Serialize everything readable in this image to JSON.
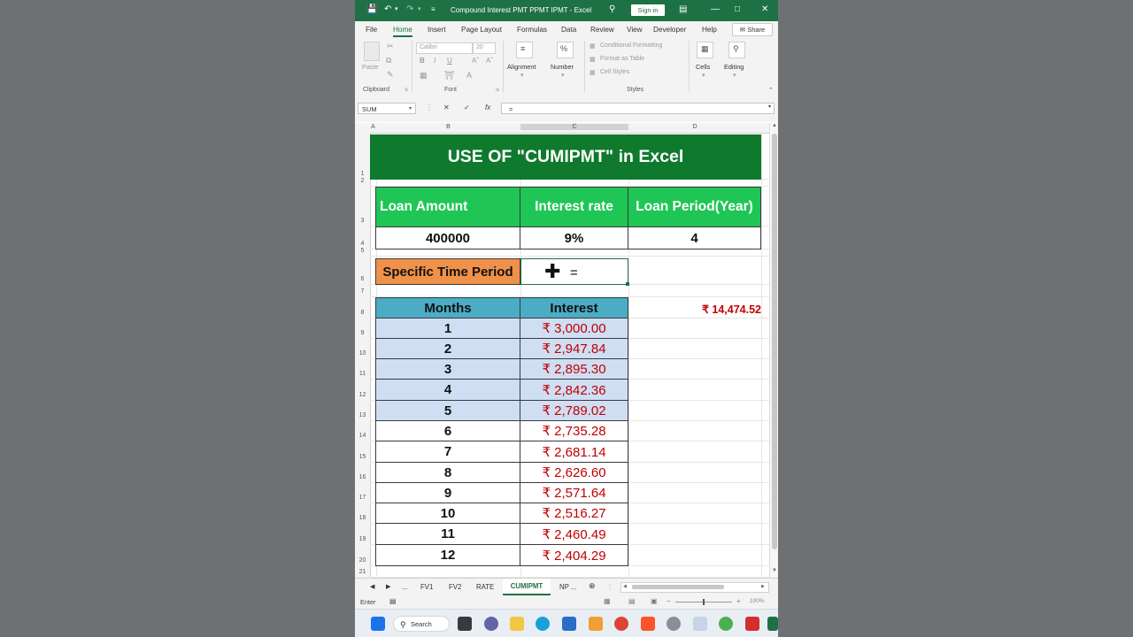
{
  "titlebar": {
    "doc_title": "Compound Interest PMT PPMT IPMT  -  Excel",
    "sign_in": "Sign in"
  },
  "menu": {
    "tabs": [
      "File",
      "Home",
      "Insert",
      "Page Layout",
      "Formulas",
      "Data",
      "Review",
      "View",
      "Developer",
      "Help"
    ],
    "share": "Share"
  },
  "ribbon": {
    "clipboard": {
      "paste": "Paste",
      "label": "Clipboard"
    },
    "font": {
      "name": "Calibri",
      "size": "20",
      "label": "Font",
      "bold": "B",
      "italic": "I",
      "underline": "U"
    },
    "alignment": "Alignment",
    "number": "Number",
    "styles": {
      "conditional": "Conditional Formatting",
      "format_table": "Format as Table",
      "cell_styles": "Cell Styles",
      "label": "Styles"
    },
    "cells": "Cells",
    "editing": "Editing"
  },
  "formula_bar": {
    "name_box": "SUM",
    "content": "="
  },
  "columns": [
    "A",
    "B",
    "C",
    "D"
  ],
  "rows": [
    "1",
    "2",
    "3",
    "4",
    "5",
    "6",
    "7",
    "8",
    "9",
    "10",
    "11",
    "12",
    "13",
    "14",
    "15",
    "16",
    "17",
    "18",
    "19",
    "20",
    "21"
  ],
  "sheet": {
    "banner": "USE OF \"CUMIPMT\" in Excel",
    "headers": [
      "Loan Amount",
      "Interest rate",
      "Loan Period(Year)"
    ],
    "values": [
      "400000",
      "9%",
      "4"
    ],
    "specific_label": "Specific Time Period",
    "specific_value": "=",
    "table_headers": [
      "Months",
      "Interest"
    ],
    "months": [
      "1",
      "2",
      "3",
      "4",
      "5",
      "6",
      "7",
      "8",
      "9",
      "10",
      "11",
      "12"
    ],
    "interest": [
      "₹ 3,000.00",
      "₹ 2,947.84",
      "₹ 2,895.30",
      "₹ 2,842.36",
      "₹ 2,789.02",
      "₹ 2,735.28",
      "₹ 2,681.14",
      "₹ 2,626.60",
      "₹ 2,571.64",
      "₹ 2,516.27",
      "₹ 2,460.49",
      "₹ 2,404.29"
    ],
    "d8_total": "₹ 14,474.52"
  },
  "sheet_tabs": [
    "...",
    "FV1",
    "FV2",
    "RATE",
    "CUMIPMT",
    "NP ..."
  ],
  "status": {
    "mode": "Enter",
    "zoom": "100%"
  },
  "taskbar": {
    "search": "Search"
  },
  "colors": {
    "excel_green": "#1e7145",
    "header_green": "#1fc655",
    "banner_green": "#0f7a2e",
    "teal": "#4bacc6",
    "orange": "#f0914a",
    "highlight_blue": "#cfdef3",
    "red": "#c00000"
  }
}
